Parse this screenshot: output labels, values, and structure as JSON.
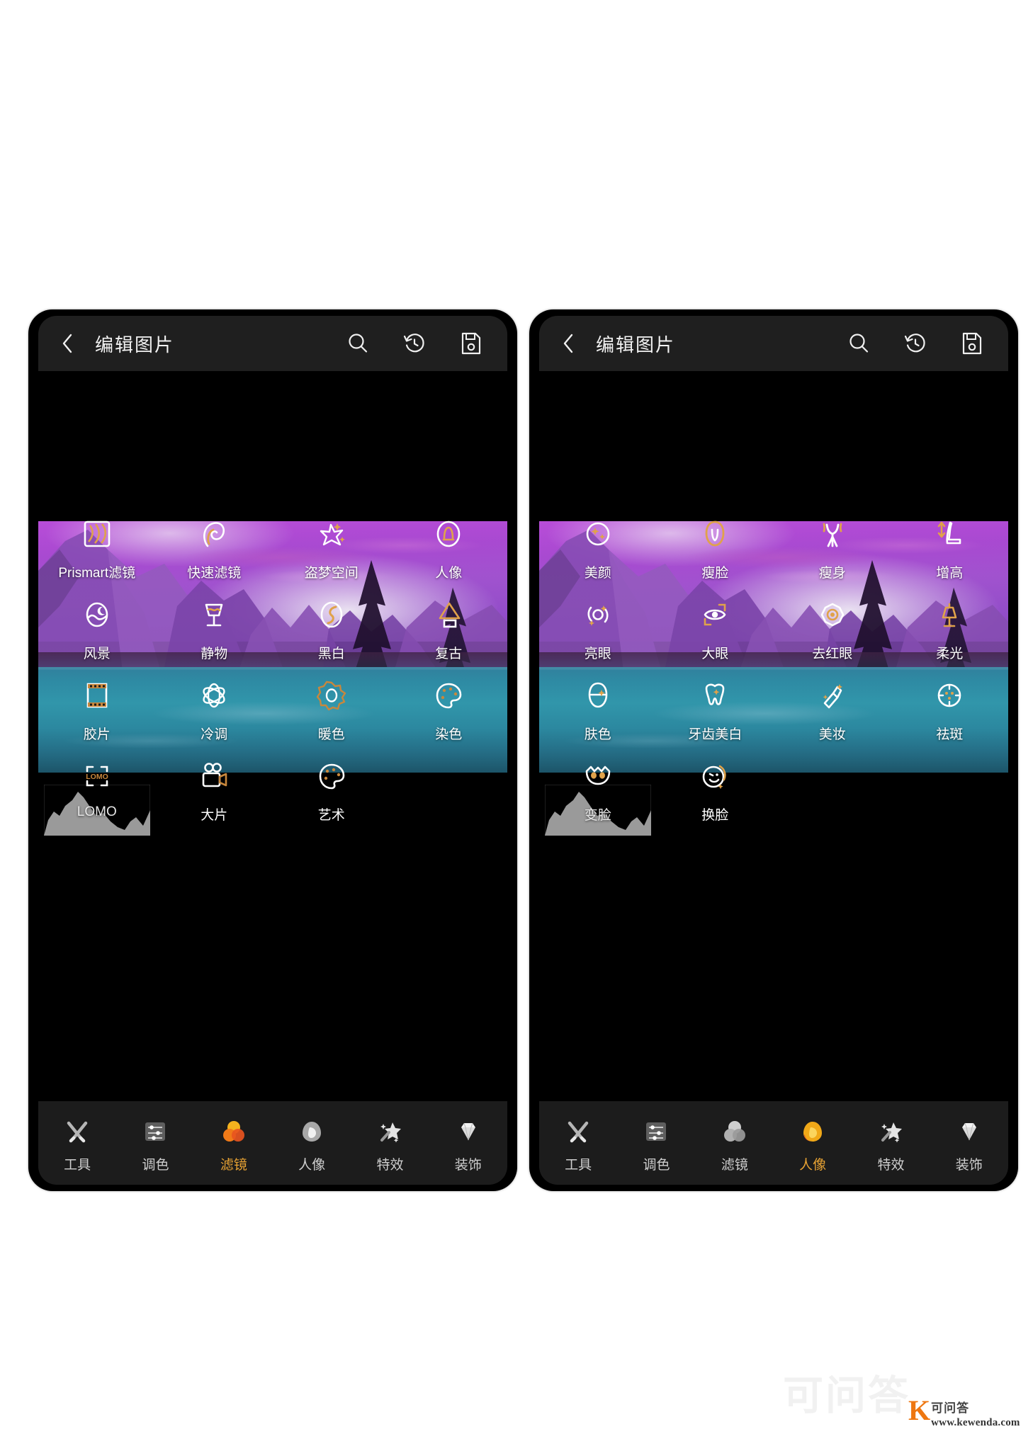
{
  "appbar": {
    "title": "编辑图片",
    "back_icon": "chevron-left-icon",
    "actions": [
      {
        "name": "search-icon",
        "label": "搜索"
      },
      {
        "name": "history-icon",
        "label": "历史"
      },
      {
        "name": "save-icon",
        "label": "保存"
      }
    ]
  },
  "panels": [
    {
      "id": "filters",
      "active_tab": "滤镜",
      "grid": [
        [
          {
            "label": "Prismart滤镜",
            "icon": "prismart-filter-icon",
            "accent": "#e0a24a"
          },
          {
            "label": "快速滤镜",
            "icon": "quick-filter-icon",
            "accent": "#e0a24a"
          },
          {
            "label": "盗梦空间",
            "icon": "inception-sparkle-icon",
            "accent": "#ffffff"
          },
          {
            "label": "人像",
            "icon": "portrait-oval-icon",
            "accent": "#e0a24a"
          }
        ],
        [
          {
            "label": "风景",
            "icon": "landscape-icon",
            "accent": "#ffffff"
          },
          {
            "label": "静物",
            "icon": "still-life-glass-icon",
            "accent": "#e0a24a"
          },
          {
            "label": "黑白",
            "icon": "black-white-icon",
            "accent": "#e0a24a"
          },
          {
            "label": "复古",
            "icon": "retro-gramophone-icon",
            "accent": "#e0a24a"
          }
        ],
        [
          {
            "label": "胶片",
            "icon": "film-strip-icon",
            "accent": "#c8873c"
          },
          {
            "label": "冷调",
            "icon": "cool-tone-atom-icon",
            "accent": "#ffffff"
          },
          {
            "label": "暖色",
            "icon": "warm-tone-sun-icon",
            "accent": "#c8873c"
          },
          {
            "label": "染色",
            "icon": "color-palette-icon",
            "accent": "#c8873c"
          }
        ],
        [
          {
            "label": "LOMO",
            "icon": "lomo-icon",
            "accent": "#c8873c",
            "has_histogram": true
          },
          {
            "label": "大片",
            "icon": "movie-camera-icon",
            "accent": "#c8873c"
          },
          {
            "label": "艺术",
            "icon": "art-palette-icon",
            "accent": "#c8873c"
          }
        ]
      ]
    },
    {
      "id": "portrait",
      "active_tab": "人像",
      "grid": [
        [
          {
            "label": "美颜",
            "icon": "beauty-face-icon",
            "accent": "#e0a24a"
          },
          {
            "label": "瘦脸",
            "icon": "slim-face-icon",
            "accent": "#e0a24a"
          },
          {
            "label": "瘦身",
            "icon": "slim-body-icon",
            "accent": "#e0a24a"
          },
          {
            "label": "增高",
            "icon": "height-increase-icon",
            "accent": "#e0a24a"
          }
        ],
        [
          {
            "label": "亮眼",
            "icon": "bright-eye-icon",
            "accent": "#e0a24a"
          },
          {
            "label": "大眼",
            "icon": "big-eye-icon",
            "accent": "#e0a24a"
          },
          {
            "label": "去红眼",
            "icon": "remove-red-eye-icon",
            "accent": "#e0a24a"
          },
          {
            "label": "柔光",
            "icon": "soft-light-lamp-icon",
            "accent": "#e0a24a"
          }
        ],
        [
          {
            "label": "肤色",
            "icon": "skin-tone-icon",
            "accent": "#e0a24a"
          },
          {
            "label": "牙齿美白",
            "icon": "teeth-whitening-icon",
            "accent": "#e0a24a"
          },
          {
            "label": "美妆",
            "icon": "makeup-lipstick-icon",
            "accent": "#e0a24a"
          },
          {
            "label": "祛斑",
            "icon": "remove-spots-icon",
            "accent": "#e0a24a"
          }
        ],
        [
          {
            "label": "变脸",
            "icon": "face-morph-mask-icon",
            "accent": "#e0a24a",
            "has_histogram": true
          },
          {
            "label": "换脸",
            "icon": "face-swap-icon",
            "accent": "#e0a24a"
          }
        ]
      ]
    }
  ],
  "tabs": [
    {
      "label": "工具",
      "icon": "tools-icon"
    },
    {
      "label": "调色",
      "icon": "color-adjust-icon"
    },
    {
      "label": "滤镜",
      "icon": "filter-icon"
    },
    {
      "label": "人像",
      "icon": "portrait-icon"
    },
    {
      "label": "特效",
      "icon": "effects-icon"
    },
    {
      "label": "装饰",
      "icon": "decoration-icon"
    }
  ],
  "colors": {
    "accent": "#e7a233",
    "appbar_bg": "#1f1f1f",
    "tabbar_bg": "#1c1c1c",
    "screen_bg": "#000000"
  },
  "watermark": {
    "ghost_text": "可问答",
    "brand_letter": "K",
    "brand_cn": "可问答",
    "brand_url": "www.kewenda.com"
  }
}
